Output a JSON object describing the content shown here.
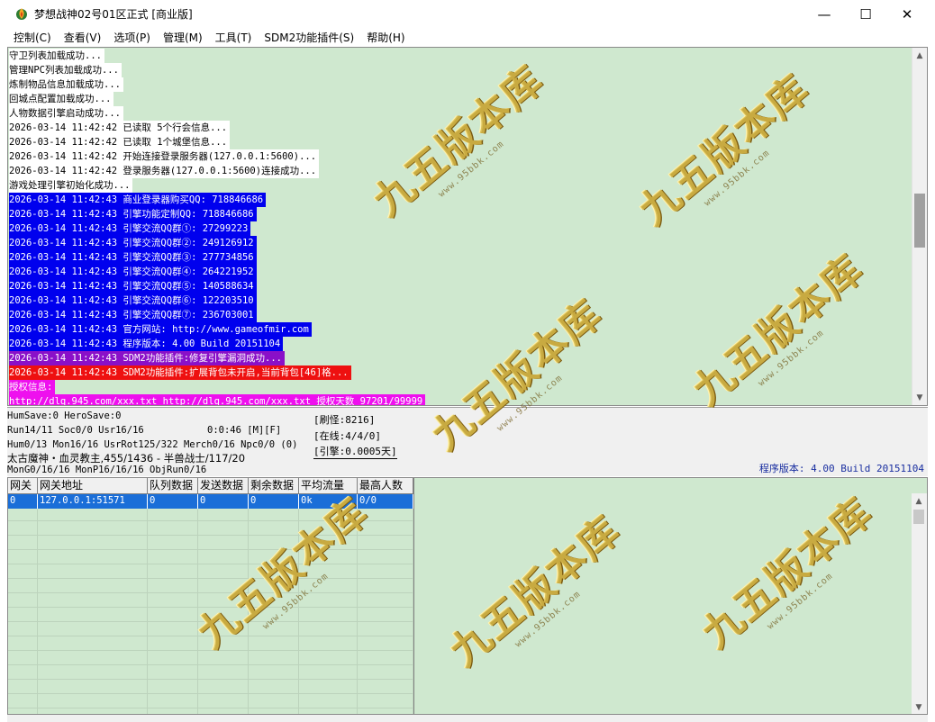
{
  "window": {
    "title": "梦想战神02号01区正式 [商业版]",
    "icon": "app-flame-icon",
    "minimize_glyph": "—",
    "maximize_glyph": "☐",
    "close_glyph": "✕"
  },
  "menu": [
    "控制(C)",
    "查看(V)",
    "选项(P)",
    "管理(M)",
    "工具(T)",
    "SDM2功能插件(S)",
    "帮助(H)"
  ],
  "log": {
    "lines": [
      {
        "text": "守卫列表加载成功...",
        "style": "white"
      },
      {
        "text": "管理NPC列表加载成功...",
        "style": "white"
      },
      {
        "text": "炼制物品信息加载成功...",
        "style": "white"
      },
      {
        "text": "回城点配置加载成功...",
        "style": "white"
      },
      {
        "text": "人物数据引擎启动成功...",
        "style": "white"
      },
      {
        "text": "2026-03-14 11:42:42 已读取 5个行会信息...",
        "style": "white"
      },
      {
        "text": "2026-03-14 11:42:42 已读取 1个城堡信息...",
        "style": "white"
      },
      {
        "text": "2026-03-14 11:42:42 开始连接登录服务器(127.0.0.1:5600)...",
        "style": "white"
      },
      {
        "text": "2026-03-14 11:42:42 登录服务器(127.0.0.1:5600)连接成功...",
        "style": "white"
      },
      {
        "text": "游戏处理引擎初始化成功...",
        "style": "white"
      },
      {
        "text": "2026-03-14 11:42:43 商业登录器购买QQ: 718846686",
        "style": "blue"
      },
      {
        "text": "2026-03-14 11:42:43 引擎功能定制QQ: 718846686",
        "style": "blue"
      },
      {
        "text": "2026-03-14 11:42:43 引擎交流QQ群①: 27299223",
        "style": "blue"
      },
      {
        "text": "2026-03-14 11:42:43 引擎交流QQ群②: 249126912",
        "style": "blue"
      },
      {
        "text": "2026-03-14 11:42:43 引擎交流QQ群③: 277734856",
        "style": "blue"
      },
      {
        "text": "2026-03-14 11:42:43 引擎交流QQ群④: 264221952",
        "style": "blue"
      },
      {
        "text": "2026-03-14 11:42:43 引擎交流QQ群⑤: 140588634",
        "style": "blue"
      },
      {
        "text": "2026-03-14 11:42:43 引擎交流QQ群⑥: 122203510",
        "style": "blue"
      },
      {
        "text": "2026-03-14 11:42:43 引擎交流QQ群⑦: 236703001",
        "style": "blue"
      },
      {
        "text": "2026-03-14 11:42:43 官方网站: http://www.gameofmir.com",
        "style": "blue"
      },
      {
        "text": "2026-03-14 11:42:43 程序版本: 4.00 Build 20151104",
        "style": "blue"
      },
      {
        "text": "2026-03-14 11:42:43 SDM2功能插件:修复引擎漏洞成功...",
        "style": "purple"
      },
      {
        "text": "2026-03-14 11:42:43 SDM2功能插件:扩展背包未开启,当前背包[46]格...",
        "style": "red"
      },
      {
        "text": "授权信息:",
        "style": "magenta"
      },
      {
        "text": "http://dlq.945.com/xxx.txt http://dlq.945.com/xxx.txt 授权天数 97201/99999",
        "style": "magenta"
      }
    ]
  },
  "status": {
    "line1": "HumSave:0 HeroSave:0",
    "line2a": "Run14/11 Soc0/0 Usr16/16",
    "line2b": "0:0:46 [M][F]",
    "line3": "Hum0/13 Mon16/16 UsrRot125/322 Merch0/16 Npc0/0 (0)",
    "line4": "太古魔神・血灵教主,455/1436 - 半兽战士/117/20",
    "line5": "MonG0/16/16 MonP16/16/16 ObjRun0/16",
    "refresh": "[刷怪:8216]",
    "online": "[在线:4/4/0]",
    "engine": "[引擎:0.0005天]",
    "version": "程序版本: 4.00 Build 20151104"
  },
  "grid": {
    "columns": [
      "网关",
      "网关地址",
      "队列数据",
      "发送数据",
      "剩余数据",
      "平均流量",
      "最高人数"
    ],
    "rows": [
      [
        "0",
        "127.0.0.1:51571",
        "0",
        "0",
        "0",
        "0k",
        "0/0"
      ]
    ]
  },
  "watermark": {
    "text": "九五版本库",
    "url": "www.95bbk.com"
  },
  "colors": {
    "panel_bg": "#cfe8cf",
    "blue_line": "#0000ee",
    "red_line": "#ee1010",
    "magenta_line": "#ee10ee",
    "purple_line": "#8a10c8",
    "selection": "#1a6ed8",
    "version_text": "#1a2fa0"
  }
}
